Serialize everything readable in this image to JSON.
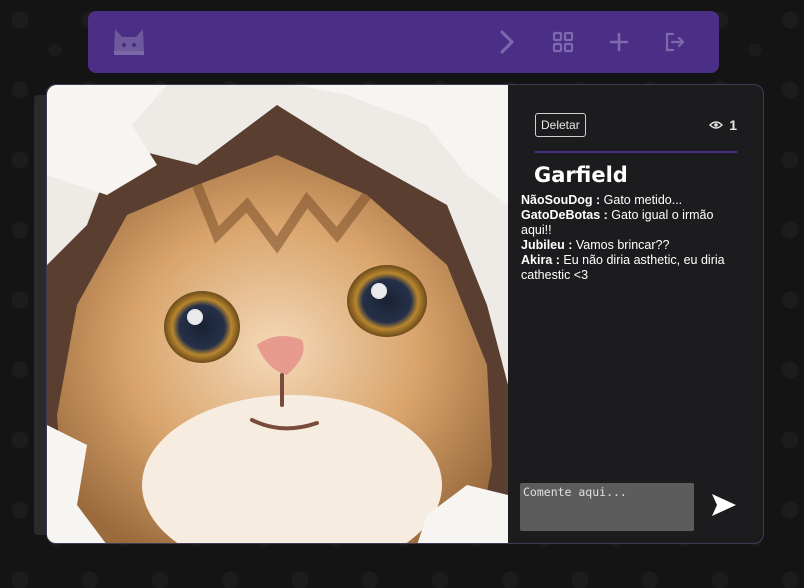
{
  "topbar": {
    "logo_icon": "cat-logo-icon",
    "nav_icons": [
      "chevron-right-icon",
      "grid-icon",
      "plus-icon",
      "logout-icon"
    ],
    "accent": "#4b2f86"
  },
  "post": {
    "delete_label": "Deletar",
    "view_count": "1",
    "title": "Garfield",
    "comments": [
      {
        "author": "NãoSouDog :",
        "text": " Gato metido..."
      },
      {
        "author": "GatoDeBotas :",
        "text": " Gato igual o irmão aqui!!"
      },
      {
        "author": "Jubileu :",
        "text": " Vamos brincar??"
      },
      {
        "author": "Akira :",
        "text": " Eu não diria asthetic, eu diria cathestic <3"
      }
    ],
    "comment_placeholder": "Comente aqui..."
  }
}
